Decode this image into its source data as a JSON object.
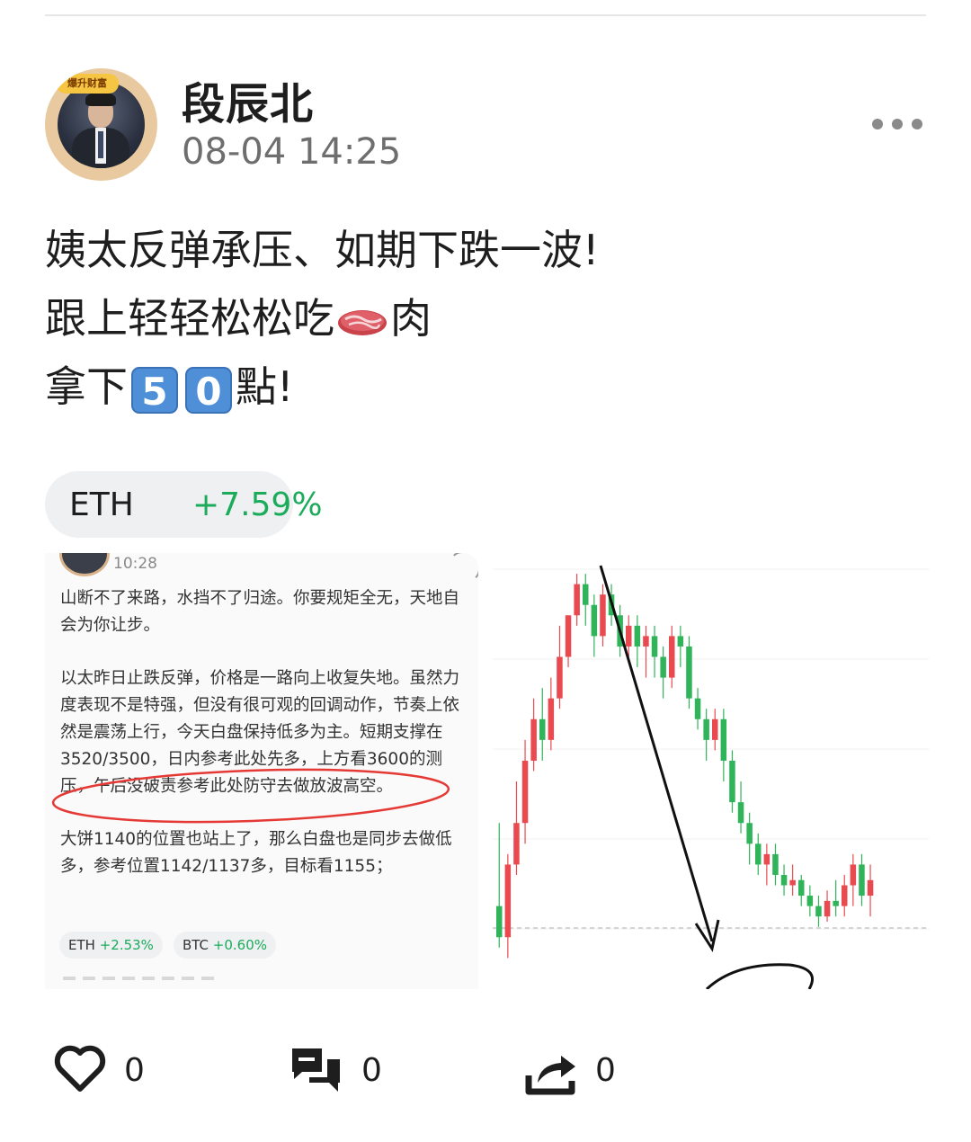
{
  "post": {
    "author": "段辰北",
    "timestamp": "08-04 14:25",
    "avatar_badge": "爆升财富",
    "text": {
      "line1": "姨太反弹承压、如期下跌一波!",
      "line2_prefix": "跟上轻轻松松吃",
      "line2_suffix": "肉",
      "line3_prefix": "拿下",
      "key1": "5",
      "key2": "0",
      "line3_suffix": "點!"
    },
    "ticker": {
      "symbol": "ETH",
      "change": "+7.59%"
    }
  },
  "screenshot": {
    "time": "10:28",
    "paragraphs": [
      "山断不了来路，水挡不了归途。你要规矩全无，天地自会为你让步。",
      "以太昨日止跌反弹，价格是一路向上收复失地。虽然力度表现不是特强，但没有很可观的回调动作，节奏上依然是震荡上行，今天白盘保持低多为主。短期支撑在3520/3500，日内参考此处先多，上方看3600的测压，午后没破责参考此处防守去做放波高空。",
      "大饼1140的位置也站上了，那么白盘也是同步去做低多，参考位置1142/1137多，目标看1155；"
    ],
    "chips": [
      {
        "symbol": "ETH",
        "change": "+2.53%"
      },
      {
        "symbol": "BTC",
        "change": "+0.60%"
      }
    ]
  },
  "actions": {
    "like_count": "0",
    "comment_count": "0",
    "share_count": "0"
  },
  "colors": {
    "up": "#1bab5b",
    "candle_up": "#e84a4f",
    "candle_down": "#2fb45a",
    "annotation_red": "#e53935"
  },
  "candles": [
    [
      3520,
      3490,
      3600,
      3480
    ],
    [
      3490,
      3560,
      3570,
      3470
    ],
    [
      3560,
      3600,
      3640,
      3550
    ],
    [
      3600,
      3660,
      3680,
      3580
    ],
    [
      3660,
      3700,
      3720,
      3650
    ],
    [
      3700,
      3680,
      3730,
      3660
    ],
    [
      3680,
      3720,
      3740,
      3670
    ],
    [
      3720,
      3760,
      3790,
      3710
    ],
    [
      3760,
      3800,
      3800,
      3750
    ],
    [
      3800,
      3830,
      3840,
      3790
    ],
    [
      3830,
      3810,
      3840,
      3790
    ],
    [
      3810,
      3780,
      3820,
      3760
    ],
    [
      3780,
      3820,
      3830,
      3770
    ],
    [
      3820,
      3800,
      3830,
      3790
    ],
    [
      3800,
      3770,
      3810,
      3760
    ],
    [
      3770,
      3790,
      3800,
      3760
    ],
    [
      3790,
      3770,
      3800,
      3750
    ],
    [
      3770,
      3780,
      3790,
      3740
    ],
    [
      3780,
      3760,
      3790,
      3740
    ],
    [
      3760,
      3740,
      3770,
      3720
    ],
    [
      3740,
      3780,
      3790,
      3730
    ],
    [
      3780,
      3770,
      3790,
      3750
    ],
    [
      3770,
      3720,
      3780,
      3710
    ],
    [
      3720,
      3700,
      3730,
      3690
    ],
    [
      3700,
      3680,
      3710,
      3660
    ],
    [
      3680,
      3700,
      3710,
      3670
    ],
    [
      3700,
      3660,
      3710,
      3640
    ],
    [
      3660,
      3620,
      3670,
      3610
    ],
    [
      3620,
      3600,
      3640,
      3590
    ],
    [
      3600,
      3580,
      3610,
      3560
    ],
    [
      3580,
      3560,
      3590,
      3550
    ],
    [
      3560,
      3570,
      3580,
      3540
    ],
    [
      3570,
      3550,
      3580,
      3540
    ],
    [
      3550,
      3540,
      3560,
      3530
    ],
    [
      3540,
      3545,
      3560,
      3530
    ],
    [
      3545,
      3530,
      3550,
      3520
    ],
    [
      3530,
      3520,
      3540,
      3510
    ],
    [
      3520,
      3510,
      3530,
      3500
    ],
    [
      3510,
      3525,
      3535,
      3505
    ],
    [
      3525,
      3520,
      3545,
      3510
    ],
    [
      3520,
      3540,
      3550,
      3510
    ],
    [
      3540,
      3560,
      3570,
      3520
    ],
    [
      3560,
      3530,
      3570,
      3520
    ],
    [
      3530,
      3545,
      3560,
      3510
    ]
  ]
}
